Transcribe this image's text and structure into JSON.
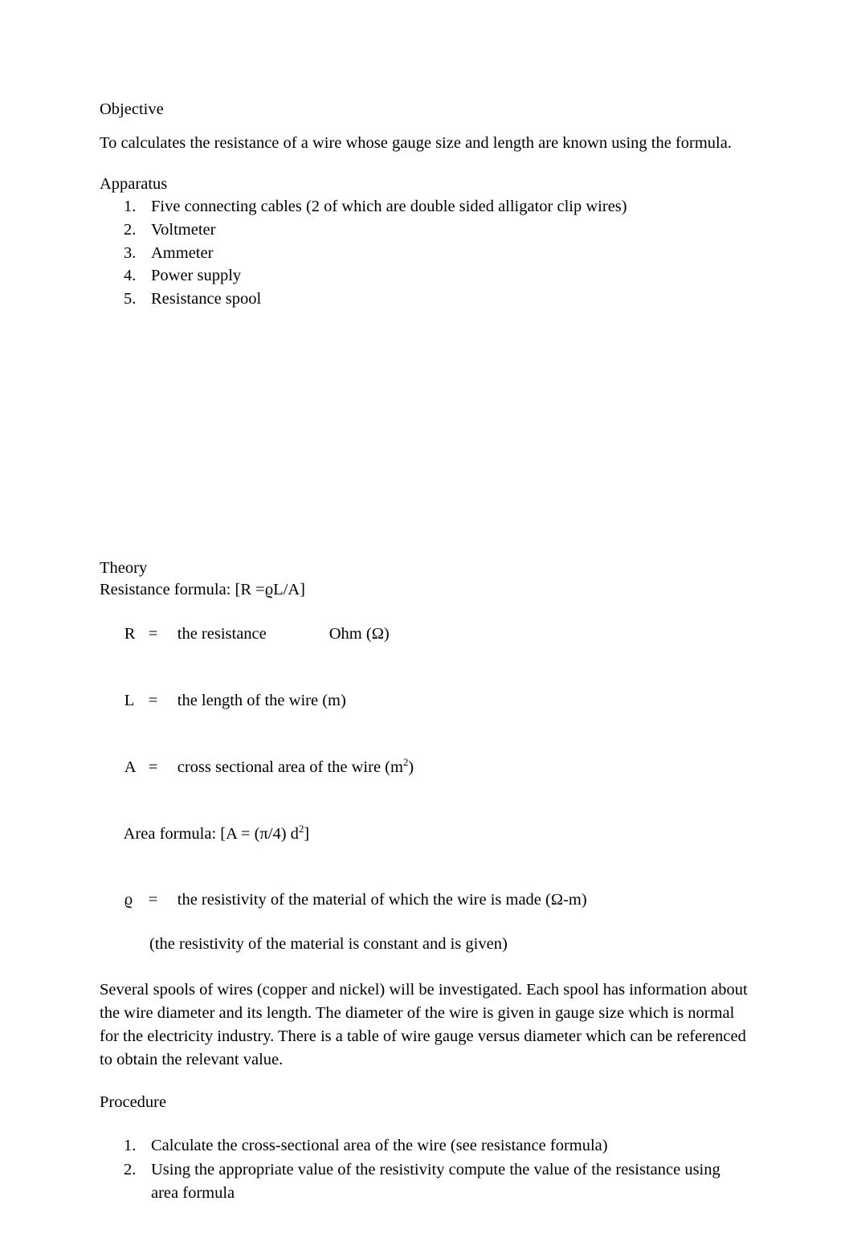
{
  "document": {
    "sections": {
      "objective": {
        "heading": "Objective",
        "body": "To calculates the resistance of a wire whose gauge size and length are known using the formula."
      },
      "apparatus": {
        "heading": "Apparatus",
        "items": [
          {
            "marker": "1.",
            "text": "Five connecting cables (2 of which are double sided alligator clip wires)"
          },
          {
            "marker": "2.",
            "text": "Voltmeter"
          },
          {
            "marker": "3.",
            "text": "Ammeter"
          },
          {
            "marker": "4.",
            "text": "Power supply"
          },
          {
            "marker": "5.",
            "text": "Resistance spool"
          }
        ]
      },
      "theory": {
        "heading": "Theory",
        "resistance_formula": "Resistance formula: [R =ϱL/A]",
        "definitions": [
          {
            "symbol": "R",
            "equals": "=",
            "description": "the resistance",
            "unit": "Ohm (Ω)"
          },
          {
            "symbol": "L",
            "equals": "=",
            "description": "the length of the wire (m)",
            "unit": ""
          },
          {
            "symbol": "A",
            "equals": "=",
            "description": "cross sectional area of the wire (m",
            "sup": "2",
            "description_tail": ")",
            "unit": ""
          }
        ],
        "area_formula_prefix": "Area formula: [A = (π/4) d",
        "area_formula_sup": "2",
        "area_formula_suffix": "]",
        "rho_definition": {
          "symbol": "ϱ",
          "equals": "=",
          "description": "the resistivity of the material of which the wire is made (Ω-m)"
        },
        "rho_note": "(the resistivity of the material is constant and is given)",
        "discussion": "Several spools of wires (copper and nickel) will be investigated. Each spool has information about the wire diameter and its length. The diameter of the wire is given in gauge size which is normal for the electricity industry. There is a table of wire gauge versus diameter which can be referenced to obtain the relevant value."
      },
      "procedure": {
        "heading": "Procedure",
        "items": [
          {
            "marker": "1.",
            "text": "Calculate the cross-sectional area of the wire (see resistance formula)"
          },
          {
            "marker": "2.",
            "text": "Using the appropriate value of the resistivity compute the value of the resistance using area formula"
          }
        ]
      }
    }
  }
}
